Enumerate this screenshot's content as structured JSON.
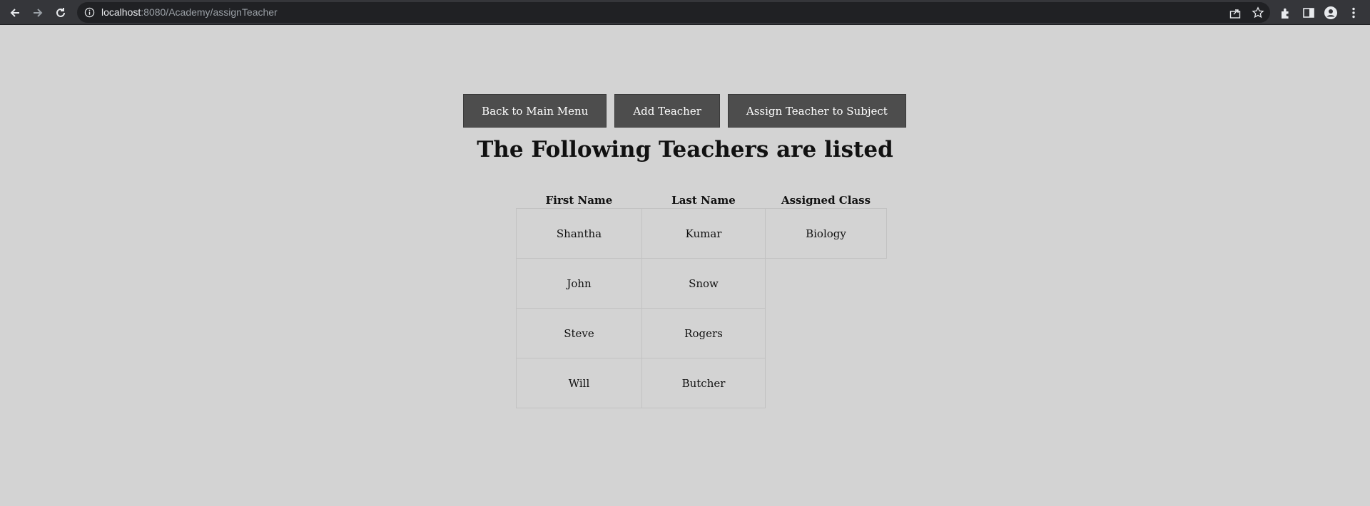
{
  "browser": {
    "url_host": "localhost",
    "url_path": ":8080/Academy/assignTeacher"
  },
  "nav": {
    "back_label": "Back to Main Menu",
    "add_label": "Add Teacher",
    "assign_label": "Assign Teacher to Subject"
  },
  "page": {
    "title": "The Following Teachers are listed"
  },
  "table": {
    "headers": [
      "First Name",
      "Last Name",
      "Assigned Class"
    ],
    "rows": [
      [
        "Shantha",
        "Kumar",
        "Biology"
      ],
      [
        "John",
        "Snow",
        ""
      ],
      [
        "Steve",
        "Rogers",
        ""
      ],
      [
        "Will",
        "Butcher",
        ""
      ]
    ]
  }
}
